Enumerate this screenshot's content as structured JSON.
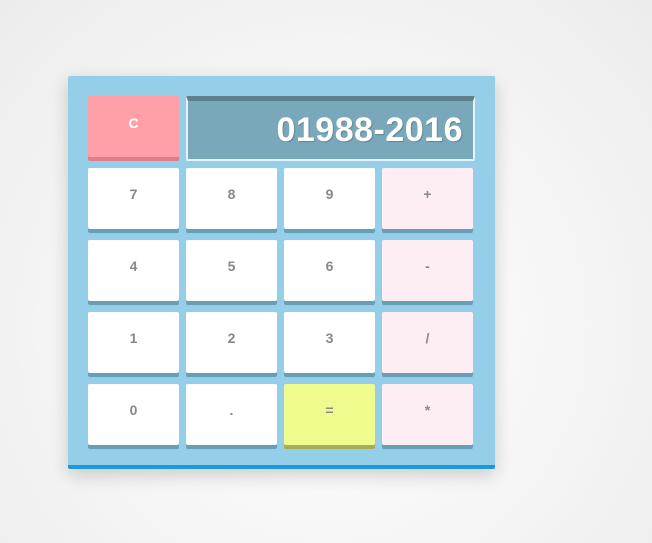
{
  "display": {
    "value": "01988-2016"
  },
  "keys": {
    "clear": "C",
    "seven": "7",
    "eight": "8",
    "nine": "9",
    "plus": "+",
    "four": "4",
    "five": "5",
    "six": "6",
    "minus": "-",
    "one": "1",
    "two": "2",
    "three": "3",
    "divide": "/",
    "zero": "0",
    "decimal": ".",
    "equals": "=",
    "multiply": "*"
  },
  "colors": {
    "body": "#95cee8",
    "body_border": "#1a9ad9",
    "display": "#7aa8bb",
    "clear_key": "#ff9fa8",
    "operator_key": "#fdeef3",
    "equals_key": "#f0fb8e",
    "number_key": "#ffffff"
  }
}
